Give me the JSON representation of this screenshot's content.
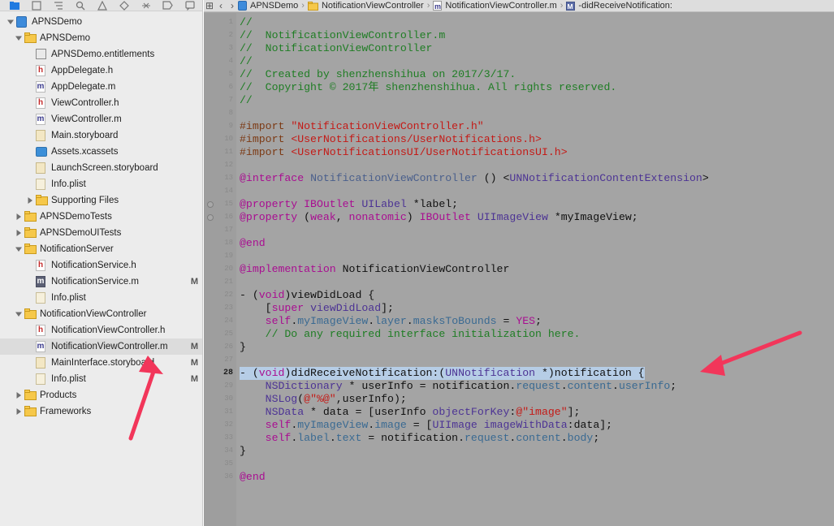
{
  "navigator": {
    "items": [
      {
        "label": "APNSDemo",
        "kind": "project",
        "level": 0,
        "disclosure": "open"
      },
      {
        "label": "APNSDemo",
        "kind": "folder",
        "level": 1,
        "disclosure": "open"
      },
      {
        "label": "APNSDemo.entitlements",
        "kind": "entitlements",
        "level": 2
      },
      {
        "label": "AppDelegate.h",
        "kind": "h",
        "level": 2
      },
      {
        "label": "AppDelegate.m",
        "kind": "m",
        "level": 2
      },
      {
        "label": "ViewController.h",
        "kind": "h",
        "level": 2
      },
      {
        "label": "ViewController.m",
        "kind": "m",
        "level": 2
      },
      {
        "label": "Main.storyboard",
        "kind": "storyboard",
        "level": 2
      },
      {
        "label": "Assets.xcassets",
        "kind": "assets",
        "level": 2
      },
      {
        "label": "LaunchScreen.storyboard",
        "kind": "storyboard",
        "level": 2
      },
      {
        "label": "Info.plist",
        "kind": "plist",
        "level": 2
      },
      {
        "label": "Supporting Files",
        "kind": "folder",
        "level": 2,
        "disclosure": "closed"
      },
      {
        "label": "APNSDemoTests",
        "kind": "folder",
        "level": 1,
        "disclosure": "closed"
      },
      {
        "label": "APNSDemoUITests",
        "kind": "folder",
        "level": 1,
        "disclosure": "closed"
      },
      {
        "label": "NotificationServer",
        "kind": "folder",
        "level": 1,
        "disclosure": "open"
      },
      {
        "label": "NotificationService.h",
        "kind": "h",
        "level": 2
      },
      {
        "label": "NotificationService.m",
        "kind": "m-dark",
        "level": 2,
        "badge": "M"
      },
      {
        "label": "Info.plist",
        "kind": "plist",
        "level": 2
      },
      {
        "label": "NotificationViewController",
        "kind": "folder",
        "level": 1,
        "disclosure": "open"
      },
      {
        "label": "NotificationViewController.h",
        "kind": "h",
        "level": 2
      },
      {
        "label": "NotificationViewController.m",
        "kind": "m",
        "level": 2,
        "badge": "M",
        "selected": true
      },
      {
        "label": "MainInterface.storyboard",
        "kind": "storyboard",
        "level": 2,
        "badge": "M"
      },
      {
        "label": "Info.plist",
        "kind": "plist",
        "level": 2,
        "badge": "M"
      },
      {
        "label": "Products",
        "kind": "folder",
        "level": 1,
        "disclosure": "closed"
      },
      {
        "label": "Frameworks",
        "kind": "folder",
        "level": 1,
        "disclosure": "closed"
      }
    ]
  },
  "jumpbar": {
    "items": [
      "APNSDemo",
      "NotificationViewController",
      "NotificationViewController.m",
      "-didReceiveNotification:"
    ]
  },
  "editor": {
    "lines": [
      {
        "n": "1",
        "spans": [
          {
            "t": "//",
            "c": "cm"
          }
        ]
      },
      {
        "n": "2",
        "spans": [
          {
            "t": "//  NotificationViewController.m",
            "c": "cm"
          }
        ]
      },
      {
        "n": "3",
        "spans": [
          {
            "t": "//  NotificationViewController",
            "c": "cm"
          }
        ]
      },
      {
        "n": "4",
        "spans": [
          {
            "t": "//",
            "c": "cm"
          }
        ]
      },
      {
        "n": "5",
        "spans": [
          {
            "t": "//  Created by shenzhenshihua on 2017/3/17.",
            "c": "cm"
          }
        ]
      },
      {
        "n": "6",
        "spans": [
          {
            "t": "//  Copyright © 2017年 shenzhenshihua. All rights reserved.",
            "c": "cm"
          }
        ]
      },
      {
        "n": "7",
        "spans": [
          {
            "t": "//",
            "c": "cm"
          }
        ]
      },
      {
        "n": "8",
        "spans": []
      },
      {
        "n": "9",
        "spans": [
          {
            "t": "#import ",
            "c": "pp"
          },
          {
            "t": "\"NotificationViewController.h\"",
            "c": "str"
          }
        ]
      },
      {
        "n": "10",
        "spans": [
          {
            "t": "#import ",
            "c": "pp"
          },
          {
            "t": "<UserNotifications/UserNotifications.h>",
            "c": "str"
          }
        ]
      },
      {
        "n": "11",
        "spans": [
          {
            "t": "#import ",
            "c": "pp"
          },
          {
            "t": "<UserNotificationsUI/UserNotificationsUI.h>",
            "c": "str"
          }
        ]
      },
      {
        "n": "12",
        "spans": []
      },
      {
        "n": "13",
        "spans": [
          {
            "t": "@interface ",
            "c": "kw"
          },
          {
            "t": "NotificationViewController",
            "c": "cl"
          },
          {
            "t": " () <",
            "c": ""
          },
          {
            "t": "UNNotificationContentExtension",
            "c": "ty"
          },
          {
            "t": ">",
            "c": ""
          }
        ]
      },
      {
        "n": "14",
        "spans": []
      },
      {
        "n": "15",
        "dot": true,
        "spans": [
          {
            "t": "@property ",
            "c": "kw"
          },
          {
            "t": "IBOutlet ",
            "c": "kw"
          },
          {
            "t": "UILabel",
            "c": "ty"
          },
          {
            "t": " *label;",
            "c": ""
          }
        ]
      },
      {
        "n": "16",
        "dot": true,
        "spans": [
          {
            "t": "@property ",
            "c": "kw"
          },
          {
            "t": "(",
            "c": ""
          },
          {
            "t": "weak",
            "c": "kw"
          },
          {
            "t": ", ",
            "c": ""
          },
          {
            "t": "nonatomic",
            "c": "kw"
          },
          {
            "t": ") ",
            "c": ""
          },
          {
            "t": "IBOutlet ",
            "c": "kw"
          },
          {
            "t": "UIImageView",
            "c": "ty"
          },
          {
            "t": " *myImageView;",
            "c": ""
          }
        ]
      },
      {
        "n": "17",
        "spans": []
      },
      {
        "n": "18",
        "spans": [
          {
            "t": "@end",
            "c": "kw"
          }
        ]
      },
      {
        "n": "19",
        "spans": []
      },
      {
        "n": "20",
        "spans": [
          {
            "t": "@implementation ",
            "c": "kw"
          },
          {
            "t": "NotificationViewController",
            "c": ""
          }
        ]
      },
      {
        "n": "21",
        "spans": []
      },
      {
        "n": "22",
        "spans": [
          {
            "t": "- (",
            "c": ""
          },
          {
            "t": "void",
            "c": "kw"
          },
          {
            "t": ")viewDidLoad {",
            "c": ""
          }
        ]
      },
      {
        "n": "23",
        "spans": [
          {
            "t": "    [",
            "c": ""
          },
          {
            "t": "super",
            "c": "kw"
          },
          {
            "t": " ",
            "c": ""
          },
          {
            "t": "viewDidLoad",
            "c": "ty"
          },
          {
            "t": "];",
            "c": ""
          }
        ]
      },
      {
        "n": "24",
        "spans": [
          {
            "t": "    ",
            "c": ""
          },
          {
            "t": "self",
            "c": "kw"
          },
          {
            "t": ".",
            "c": ""
          },
          {
            "t": "myImageView",
            "c": "pr"
          },
          {
            "t": ".",
            "c": ""
          },
          {
            "t": "layer",
            "c": "pr"
          },
          {
            "t": ".",
            "c": ""
          },
          {
            "t": "masksToBounds",
            "c": "pr"
          },
          {
            "t": " = ",
            "c": ""
          },
          {
            "t": "YES",
            "c": "kw"
          },
          {
            "t": ";",
            "c": ""
          }
        ]
      },
      {
        "n": "25",
        "spans": [
          {
            "t": "    // Do any required interface initialization here.",
            "c": "cm"
          }
        ]
      },
      {
        "n": "26",
        "spans": [
          {
            "t": "}",
            "c": ""
          }
        ]
      },
      {
        "n": "27",
        "spans": []
      },
      {
        "n": "28",
        "current": true,
        "spans": [
          {
            "t": "- (",
            "c": ""
          },
          {
            "t": "void",
            "c": "kw"
          },
          {
            "t": ")didReceiveNotification:(",
            "c": ""
          },
          {
            "t": "UNNotification",
            "c": "ty"
          },
          {
            "t": " *)notification {",
            "c": ""
          }
        ]
      },
      {
        "n": "29",
        "spans": [
          {
            "t": "    ",
            "c": ""
          },
          {
            "t": "NSDictionary",
            "c": "ty"
          },
          {
            "t": " * userInfo = notification.",
            "c": ""
          },
          {
            "t": "request",
            "c": "pr"
          },
          {
            "t": ".",
            "c": ""
          },
          {
            "t": "content",
            "c": "pr"
          },
          {
            "t": ".",
            "c": ""
          },
          {
            "t": "userInfo",
            "c": "pr"
          },
          {
            "t": ";",
            "c": ""
          }
        ]
      },
      {
        "n": "30",
        "spans": [
          {
            "t": "    ",
            "c": ""
          },
          {
            "t": "NSLog",
            "c": "ty"
          },
          {
            "t": "(",
            "c": ""
          },
          {
            "t": "@\"%@\"",
            "c": "str"
          },
          {
            "t": ",userInfo);",
            "c": ""
          }
        ]
      },
      {
        "n": "31",
        "spans": [
          {
            "t": "    ",
            "c": ""
          },
          {
            "t": "NSData",
            "c": "ty"
          },
          {
            "t": " * data = [userInfo ",
            "c": ""
          },
          {
            "t": "objectForKey",
            "c": "ty"
          },
          {
            "t": ":",
            "c": ""
          },
          {
            "t": "@\"image\"",
            "c": "str"
          },
          {
            "t": "];",
            "c": ""
          }
        ]
      },
      {
        "n": "32",
        "spans": [
          {
            "t": "    ",
            "c": ""
          },
          {
            "t": "self",
            "c": "kw"
          },
          {
            "t": ".",
            "c": ""
          },
          {
            "t": "myImageView",
            "c": "pr"
          },
          {
            "t": ".",
            "c": ""
          },
          {
            "t": "image",
            "c": "pr"
          },
          {
            "t": " = [",
            "c": ""
          },
          {
            "t": "UIImage",
            "c": "ty"
          },
          {
            "t": " ",
            "c": ""
          },
          {
            "t": "imageWithData",
            "c": "ty"
          },
          {
            "t": ":data];",
            "c": ""
          }
        ]
      },
      {
        "n": "33",
        "spans": [
          {
            "t": "    ",
            "c": ""
          },
          {
            "t": "self",
            "c": "kw"
          },
          {
            "t": ".",
            "c": ""
          },
          {
            "t": "label",
            "c": "pr"
          },
          {
            "t": ".",
            "c": ""
          },
          {
            "t": "text",
            "c": "pr"
          },
          {
            "t": " = notification.",
            "c": ""
          },
          {
            "t": "request",
            "c": "pr"
          },
          {
            "t": ".",
            "c": ""
          },
          {
            "t": "content",
            "c": "pr"
          },
          {
            "t": ".",
            "c": ""
          },
          {
            "t": "body",
            "c": "pr"
          },
          {
            "t": ";",
            "c": ""
          }
        ]
      },
      {
        "n": "34",
        "spans": [
          {
            "t": "}",
            "c": ""
          }
        ]
      },
      {
        "n": "35",
        "spans": []
      },
      {
        "n": "36",
        "spans": [
          {
            "t": "@end",
            "c": "kw"
          }
        ]
      }
    ]
  },
  "colors": {
    "annotation_arrow": "#f2365a",
    "selection_highlight": "#b6cde6",
    "comment": "#1f7d24",
    "string": "#c41a16",
    "keyword": "#a90d91"
  }
}
